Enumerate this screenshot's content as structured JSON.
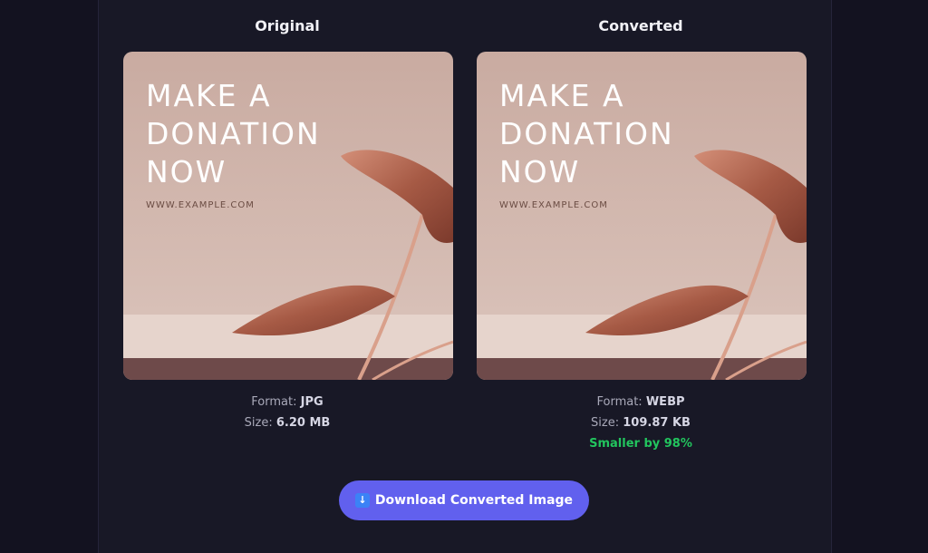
{
  "original": {
    "heading": "Original",
    "poster": {
      "headline": "MAKE A\nDONATION\nNOW",
      "url": "WWW.EXAMPLE.COM"
    },
    "format_label": "Format:",
    "format_value": "JPG",
    "size_label": "Size:",
    "size_value": "6.20 MB"
  },
  "converted": {
    "heading": "Converted",
    "poster": {
      "headline": "MAKE A\nDONATION\nNOW",
      "url": "WWW.EXAMPLE.COM"
    },
    "format_label": "Format:",
    "format_value": "WEBP",
    "size_label": "Size:",
    "size_value": "109.87 KB",
    "saving": "Smaller by 98%"
  },
  "download": {
    "icon": "download-arrow-icon",
    "label": "Download Converted Image"
  },
  "colors": {
    "background": "#131220",
    "panel": "#181826",
    "accent": "#6160ee",
    "success": "#22c55e"
  }
}
